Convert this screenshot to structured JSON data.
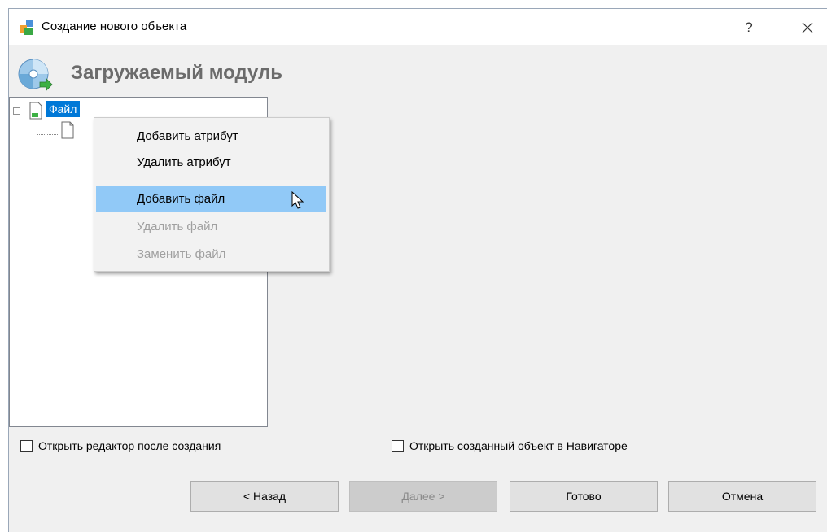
{
  "window": {
    "title": "Создание нового объекта",
    "help_label": "?"
  },
  "header": {
    "title": "Загружаемый модуль"
  },
  "tree": {
    "root_label": "Файл"
  },
  "context_menu": {
    "items": [
      {
        "label": "Добавить атрибут",
        "state": "enabled"
      },
      {
        "label": "Удалить атрибут",
        "state": "enabled"
      },
      {
        "label": "Добавить файл",
        "state": "hover"
      },
      {
        "label": "Удалить файл",
        "state": "disabled"
      },
      {
        "label": "Заменить файл",
        "state": "disabled"
      }
    ]
  },
  "options": {
    "open_editor_label": "Открыть редактор после создания",
    "open_editor_checked": false,
    "open_in_navigator_label": "Открыть созданный объект в Навигаторе",
    "open_in_navigator_checked": false
  },
  "buttons": {
    "back": "< Назад",
    "next": "Далее >",
    "finish": "Готово",
    "cancel": "Отмена"
  },
  "colors": {
    "selection": "#0078d7",
    "menu_hover": "#91c9f7",
    "disabled_text": "#a0a0a0"
  },
  "icons": {
    "app": "app-cubes-icon",
    "header": "module-disc-icon",
    "root_node": "file-icon",
    "child_node": "document-icon",
    "close": "close-icon",
    "cursor": "mouse-cursor-icon"
  }
}
